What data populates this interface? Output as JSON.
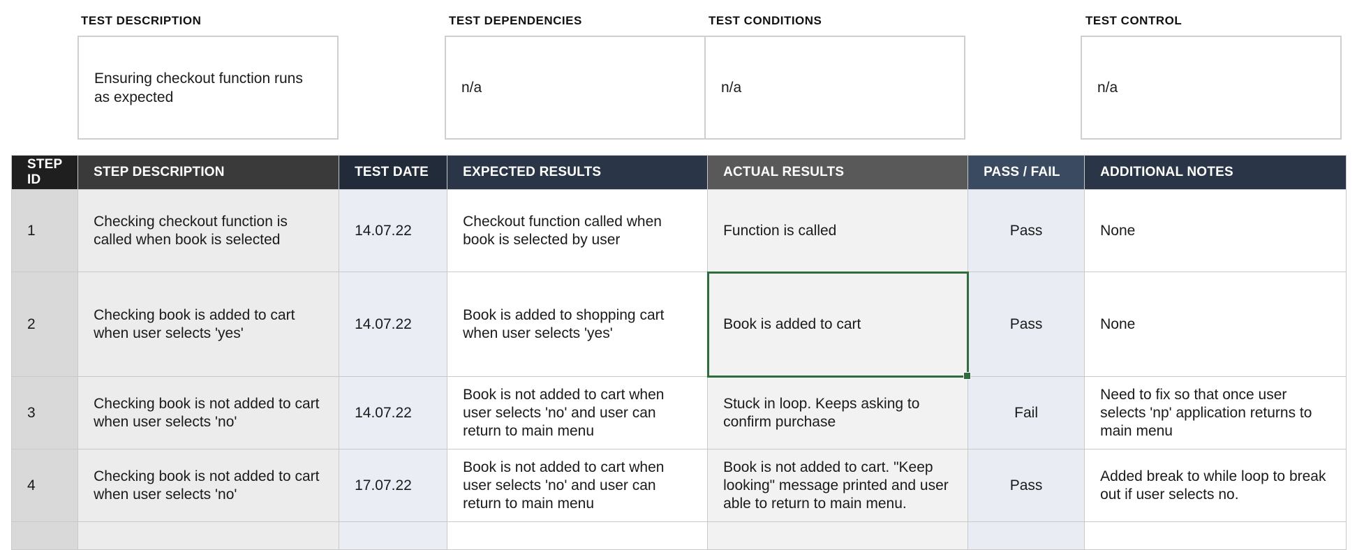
{
  "header": {
    "description_label": "TEST DESCRIPTION",
    "description_value": "Ensuring checkout function runs as expected",
    "dependencies_label": "TEST DEPENDENCIES",
    "dependencies_value": "n/a",
    "conditions_label": "TEST CONDITIONS",
    "conditions_value": "n/a",
    "control_label": "TEST CONTROL",
    "control_value": "n/a"
  },
  "table": {
    "columns": [
      "STEP ID",
      "STEP DESCRIPTION",
      "TEST DATE",
      "EXPECTED RESULTS",
      "ACTUAL RESULTS",
      "PASS / FAIL",
      "ADDITIONAL NOTES"
    ],
    "rows": [
      {
        "step_id": "1",
        "step_description": "Checking checkout function is called when book is selected",
        "test_date": "14.07.22",
        "expected_results": "Checkout function called when book is selected by user",
        "actual_results": "Function is called",
        "pass_fail": "Pass",
        "additional_notes": "None"
      },
      {
        "step_id": "2",
        "step_description": "Checking book is added to cart when user selects 'yes'",
        "test_date": "14.07.22",
        "expected_results": "Book is added to shopping cart when user selects 'yes'",
        "actual_results": "Book is added to cart",
        "pass_fail": "Pass",
        "additional_notes": "None"
      },
      {
        "step_id": "3",
        "step_description": "Checking book is not added to cart when user selects 'no'",
        "test_date": "14.07.22",
        "expected_results": "Book is not added to cart when user selects 'no' and user can return to main menu",
        "actual_results": "Stuck in loop. Keeps asking to confirm purchase",
        "pass_fail": "Fail",
        "additional_notes": "Need to fix so that once user selects 'np' application returns to main menu"
      },
      {
        "step_id": "4",
        "step_description": "Checking book is not added to cart when user selects 'no'",
        "test_date": "17.07.22",
        "expected_results": "Book is not added to cart when user selects 'no' and user can return to main menu",
        "actual_results": "Book is not added to cart. \"Keep looking\" message printed and user able to return to main menu.",
        "pass_fail": "Pass",
        "additional_notes": "Added break to while loop to break out if user selects no."
      }
    ]
  },
  "colors": {
    "selection_border": "#2e6e3c",
    "header_dark": "#1f1f1f",
    "header_navy": "#2a3648",
    "header_gray": "#595959"
  }
}
